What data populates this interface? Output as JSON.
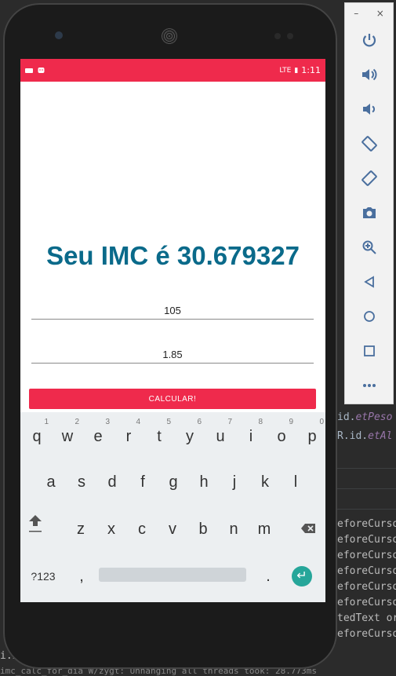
{
  "ide": {
    "line1_prefix": "id.",
    "line1_id": "etPeso",
    "line2_prefix": "R.id.",
    "line2_id": "etAl",
    "log_lines": [
      "eforeCurso",
      "eforeCurso",
      "eforeCurso",
      "eforeCurso",
      "eforeCurso",
      "eforeCurso",
      "tedText or",
      "eforeCurso"
    ],
    "log_bottom": "i.im                    ive",
    "log_last": "imc_calc_for_dia W/zygt: Unhanging all threads took: 28.773ms"
  },
  "status_bar": {
    "left_icons": [
      "notification-icon",
      "android-icon"
    ],
    "signal": "LTE",
    "battery": "▮",
    "time": "1:11"
  },
  "app": {
    "result_text": "Seu IMC é 30.679327",
    "peso_value": "105",
    "altura_value": "1.85",
    "button_label": "CALCULAR!"
  },
  "keyboard": {
    "row1": [
      {
        "k": "q",
        "h": "1"
      },
      {
        "k": "w",
        "h": "2"
      },
      {
        "k": "e",
        "h": "3"
      },
      {
        "k": "r",
        "h": "4"
      },
      {
        "k": "t",
        "h": "5"
      },
      {
        "k": "y",
        "h": "6"
      },
      {
        "k": "u",
        "h": "7"
      },
      {
        "k": "i",
        "h": "8"
      },
      {
        "k": "o",
        "h": "9"
      },
      {
        "k": "p",
        "h": "0"
      }
    ],
    "row2": [
      "a",
      "s",
      "d",
      "f",
      "g",
      "h",
      "j",
      "k",
      "l"
    ],
    "row3": [
      "z",
      "x",
      "c",
      "v",
      "b",
      "n",
      "m"
    ],
    "symbols_label": "?123",
    "comma": ",",
    "period": "."
  },
  "toolbar": {
    "minimize": "–",
    "close": "×",
    "buttons": [
      "power-icon",
      "volume-up-icon",
      "volume-down-icon",
      "rotate-left-icon",
      "rotate-right-icon",
      "camera-icon",
      "zoom-icon",
      "back-icon",
      "home-icon",
      "overview-icon",
      "more-icon"
    ]
  }
}
